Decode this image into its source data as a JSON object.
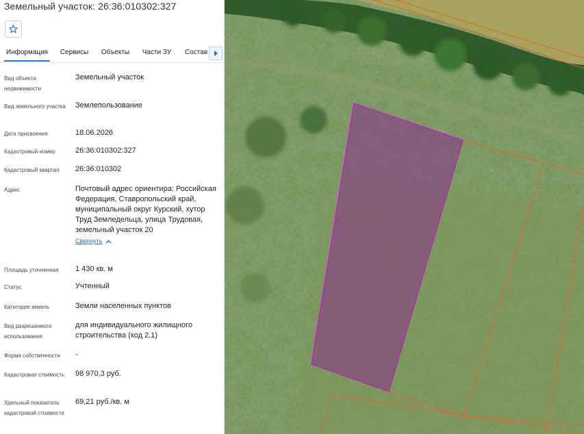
{
  "header": {
    "title": "Земельный участок: 26:36:010302:327"
  },
  "tabs": [
    {
      "label": "Информация",
      "active": true
    },
    {
      "label": "Сервисы",
      "active": false
    },
    {
      "label": "Объекты",
      "active": false
    },
    {
      "label": "Части ЗУ",
      "active": false
    },
    {
      "label": "Состав",
      "active": false
    }
  ],
  "fields": {
    "object_type": {
      "label": "Вид объекта недвижимости",
      "value": "Земельный участок"
    },
    "land_type": {
      "label": "Вид земельного участка",
      "value": "Землепользование"
    },
    "assigned_date": {
      "label": "Дата присвоения",
      "value": "18.06.2026"
    },
    "cadastral_number": {
      "label": "Кадастровый номер",
      "value": "26:36:010302:327"
    },
    "cadastral_block": {
      "label": "Кадастровый квартал",
      "value": "26:36:010302"
    },
    "address": {
      "label": "Адрес",
      "value": "Почтовый адрес ориентира: Российская Федерация, Ставропольский край, муниципальный округ Курский, хутор Труд Земледельца, улица Трудовая, земельный участок 20",
      "collapse_label": "Свернуть"
    },
    "area": {
      "label": "Площадь уточненная",
      "value": "1 430 кв. м"
    },
    "status": {
      "label": "Статус",
      "value": "Учтенный"
    },
    "land_category": {
      "label": "Категория земель",
      "value": "Земли населенных пунктов"
    },
    "permitted_use": {
      "label": "Вид разрешенного использования",
      "value": "для индивидуального жилищного строительства (код 2.1)"
    },
    "ownership": {
      "label": "Форма собственности",
      "value": "-"
    },
    "cadastral_value": {
      "label": "Кадастровая стоимость",
      "value": "98 970,3 руб."
    },
    "specific_value": {
      "label": "Удельный показатель кадастровой стоимости",
      "value": "69,21 руб./кв. м"
    }
  },
  "icons": {
    "favorite": "star-icon",
    "tabs_next": "chevron-right-icon",
    "collapse": "chevron-up-icon"
  },
  "colors": {
    "accent": "#1f6fd1",
    "selected_parcel_stroke": "#c21fc4",
    "selected_parcel_fill": "#8a2d8c",
    "parcel_boundary": "#e8642a"
  }
}
